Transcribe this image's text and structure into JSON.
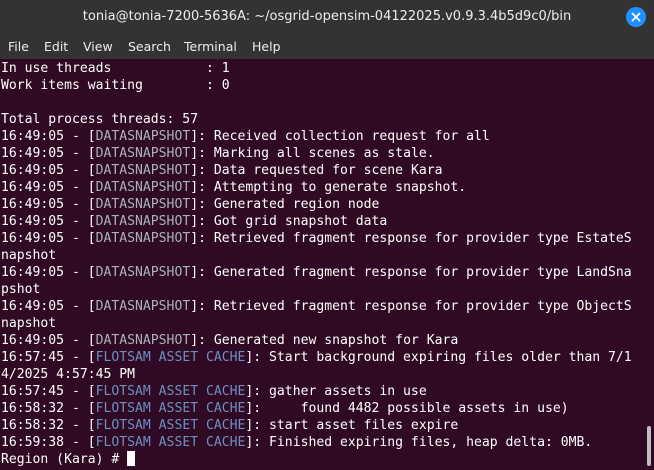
{
  "window": {
    "title": "tonia@tonia-7200-5636A: ~/osgrid-opensim-04122025.v0.9.3.4b5d9c0/bin"
  },
  "menu": [
    "File",
    "Edit",
    "View",
    "Search",
    "Terminal",
    "Help"
  ],
  "terminal": {
    "lines": [
      {
        "text": "In use threads            : 1"
      },
      {
        "text": "Work items waiting        : 0"
      },
      {
        "text": ""
      },
      {
        "text": "Total process threads: 57"
      },
      {
        "time": "16:49:05 - [",
        "tag": "DATASNAPSHOT",
        "rest": "]: Received collection request for all",
        "kind": "ds"
      },
      {
        "time": "16:49:05 - [",
        "tag": "DATASNAPSHOT",
        "rest": "]: Marking all scenes as stale.",
        "kind": "ds"
      },
      {
        "time": "16:49:05 - [",
        "tag": "DATASNAPSHOT",
        "rest": "]: Data requested for scene Kara",
        "kind": "ds"
      },
      {
        "time": "16:49:05 - [",
        "tag": "DATASNAPSHOT",
        "rest": "]: Attempting to generate snapshot.",
        "kind": "ds"
      },
      {
        "time": "16:49:05 - [",
        "tag": "DATASNAPSHOT",
        "rest": "]: Generated region node",
        "kind": "ds"
      },
      {
        "time": "16:49:05 - [",
        "tag": "DATASNAPSHOT",
        "rest": "]: Got grid snapshot data",
        "kind": "ds"
      },
      {
        "time": "16:49:05 - [",
        "tag": "DATASNAPSHOT",
        "rest": "]: Retrieved fragment response for provider type EstateS",
        "kind": "ds"
      },
      {
        "text": "napshot"
      },
      {
        "time": "16:49:05 - [",
        "tag": "DATASNAPSHOT",
        "rest": "]: Generated fragment response for provider type LandSna",
        "kind": "ds"
      },
      {
        "text": "pshot"
      },
      {
        "time": "16:49:05 - [",
        "tag": "DATASNAPSHOT",
        "rest": "]: Retrieved fragment response for provider type ObjectS",
        "kind": "ds"
      },
      {
        "text": "napshot"
      },
      {
        "time": "16:49:05 - [",
        "tag": "DATASNAPSHOT",
        "rest": "]: Generated new snapshot for Kara",
        "kind": "ds"
      },
      {
        "time": "16:57:45 - [",
        "tag": "FLOTSAM ASSET CACHE",
        "rest": "]: Start background expiring files older than 7/1",
        "kind": "fl"
      },
      {
        "text": "4/2025 4:57:45 PM"
      },
      {
        "time": "16:57:45 - [",
        "tag": "FLOTSAM ASSET CACHE",
        "rest": "]: gather assets in use",
        "kind": "fl"
      },
      {
        "time": "16:58:32 - [",
        "tag": "FLOTSAM ASSET CACHE",
        "rest": "]:     found 4482 possible assets in use)",
        "kind": "fl"
      },
      {
        "time": "16:58:32 - [",
        "tag": "FLOTSAM ASSET CACHE",
        "rest": "]: start asset files expire",
        "kind": "fl"
      },
      {
        "time": "16:59:38 - [",
        "tag": "FLOTSAM ASSET CACHE",
        "rest": "]: Finished expiring files, heap delta: 0MB.",
        "kind": "fl"
      }
    ],
    "prompt": "Region (Kara) # "
  },
  "colors": {
    "terminal_bg": "#300a24",
    "text": "#ffffff",
    "datasnapshot_tag": "#a8b2bd",
    "flotsam_tag": "#6e8fc2",
    "close_button": "#1e90ff"
  },
  "icons": {
    "close": "close-icon"
  }
}
